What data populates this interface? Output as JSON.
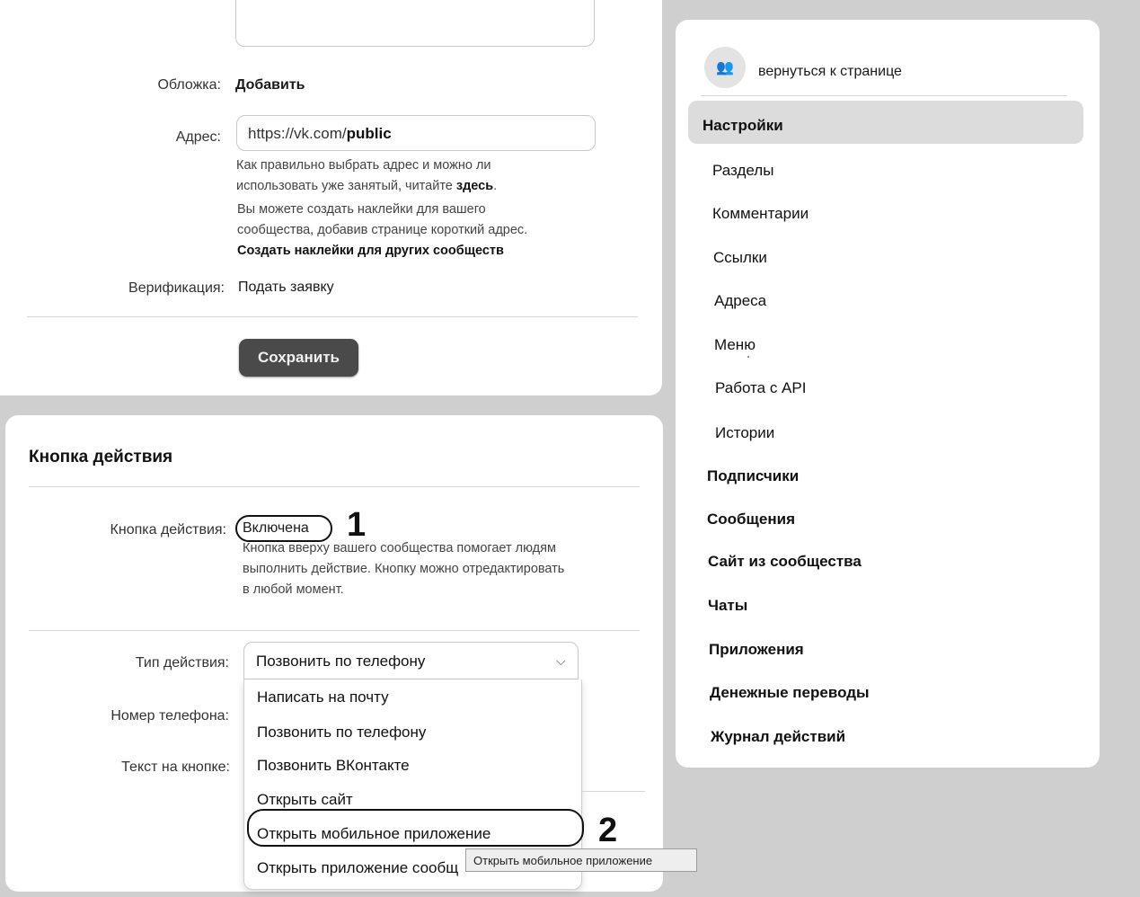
{
  "settings_form": {
    "cover_label": "Обложка:",
    "cover_action": "Добавить",
    "address_label": "Адрес:",
    "address_value_prefix": "https://vk.com/",
    "address_value_bold": "public",
    "address_hint_line1": "Как правильно выбрать адрес и можно ли",
    "address_hint_line2_prefix": "использовать уже занятый, читайте ",
    "address_hint_link": "здесь",
    "sticker_hint_line1": "Вы можете создать наклейки для вашего",
    "sticker_hint_line2": "сообщества, добавив странице короткий адрес.",
    "sticker_link": "Создать наклейки для других сообществ",
    "verification_label": "Верификация:",
    "verification_action": "Подать заявку",
    "save_button": "Сохранить"
  },
  "action_button_section": {
    "title": "Кнопка действия",
    "toggle_label": "Кнопка действия:",
    "toggle_value": "Включена",
    "annotation_1": "1",
    "description_line1": "Кнопка вверху вашего сообщества помогает людям",
    "description_line2": "выполнить действие. Кнопку можно отредактировать",
    "description_line3": "в любой момент.",
    "action_type_label": "Тип действия:",
    "action_type_selected": "Позвонить по телефону",
    "phone_label": "Номер телефона:",
    "button_text_label": "Текст на кнопке:",
    "dropdown_options": [
      "Написать на почту",
      "Позвонить по телефону",
      "Позвонить ВКонтакте",
      "Открыть сайт",
      "Открыть мобильное приложение",
      "Открыть приложение сообщ"
    ],
    "annotation_2": "2",
    "tooltip": "Открыть мобильное приложение"
  },
  "sidebar": {
    "back_link": "вернуться к странице",
    "active_item": "Настройки",
    "sub_items": [
      "Разделы",
      "Комментарии",
      "Ссылки",
      "Адреса",
      "Меню",
      "Работа с API",
      "Истории"
    ],
    "items": [
      "Подписчики",
      "Сообщения",
      "Сайт из сообщества",
      "Чаты",
      "Приложения",
      "Денежные переводы",
      "Журнал действий"
    ]
  }
}
